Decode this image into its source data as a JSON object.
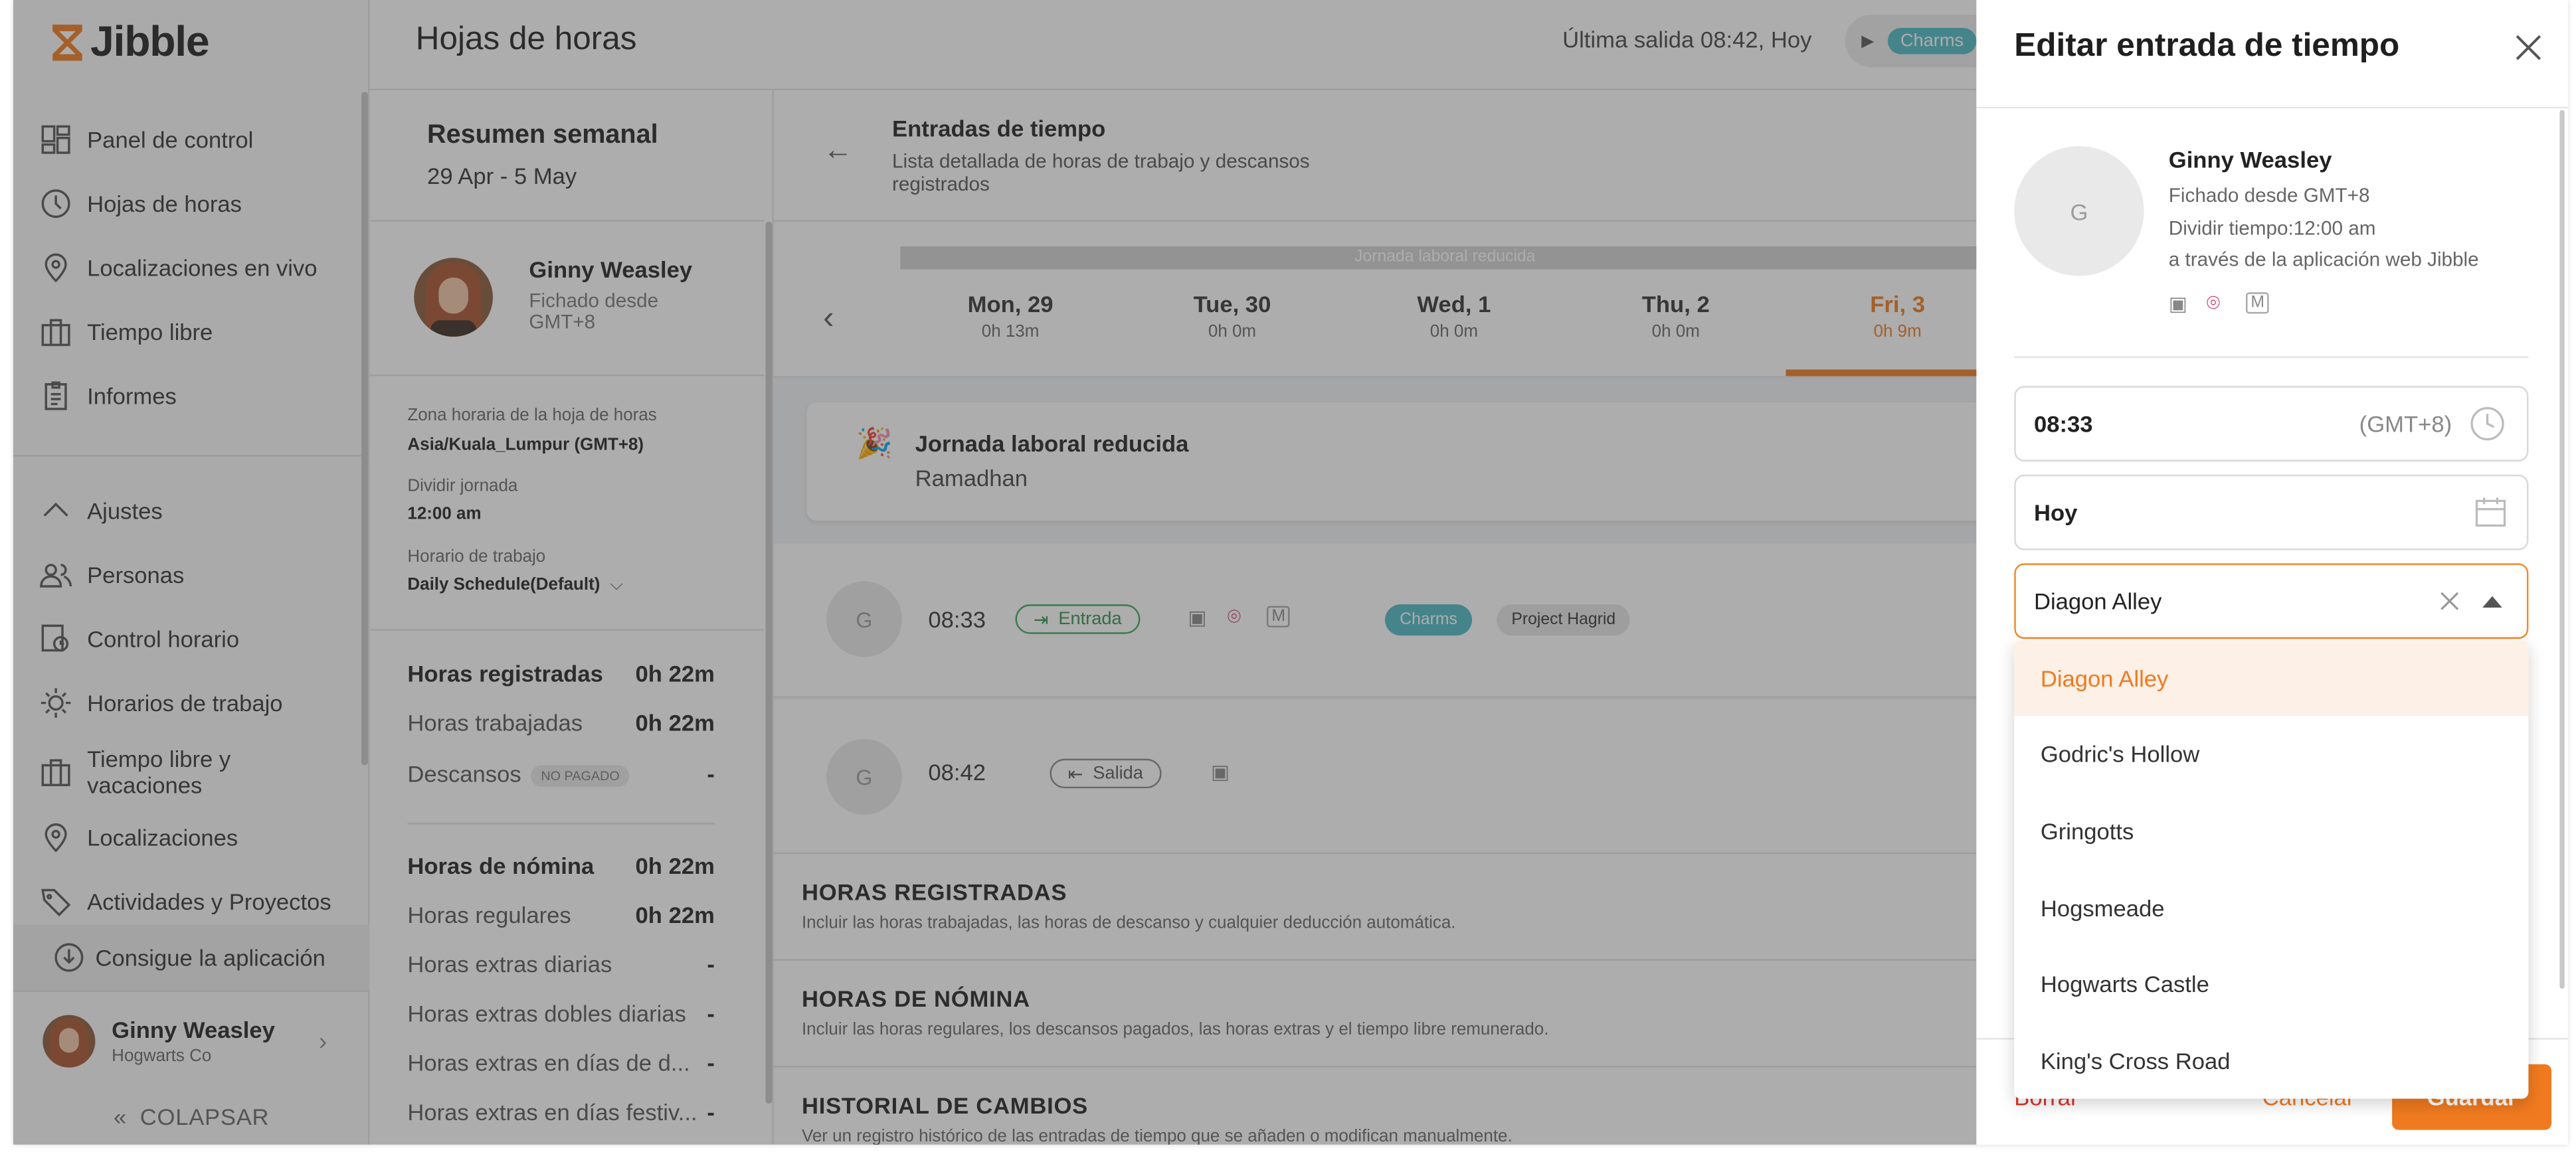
{
  "app": {
    "logo_text": "Jibble",
    "page_title": "Hojas de horas",
    "brand_color": "#f07a1f"
  },
  "sidebar": {
    "items": [
      {
        "label": "Panel de control",
        "icon": "dashboard-icon"
      },
      {
        "label": "Hojas de horas",
        "icon": "clock-icon"
      },
      {
        "label": "Localizaciones en vivo",
        "icon": "location-pin-icon"
      },
      {
        "label": "Tiempo libre",
        "icon": "briefcase-icon"
      },
      {
        "label": "Informes",
        "icon": "clipboard-icon"
      }
    ],
    "settings_label": "Ajustes",
    "settings_items": [
      {
        "label": "Personas",
        "icon": "people-icon"
      },
      {
        "label": "Control horario",
        "icon": "time-tracking-icon"
      },
      {
        "label": "Horarios de trabajo",
        "icon": "sun-schedule-icon"
      },
      {
        "label": "Tiempo libre y vacaciones",
        "icon": "briefcase-icon"
      },
      {
        "label": "Localizaciones",
        "icon": "location-pin-icon"
      },
      {
        "label": "Actividades y Proyectos",
        "icon": "tag-icon"
      }
    ],
    "get_app": "Consigue la aplicación",
    "user": {
      "name": "Ginny Weasley",
      "org": "Hogwarts Co"
    },
    "collapse": "COLAPSAR"
  },
  "header": {
    "last_out": "Última salida 08:42, Hoy",
    "clock_chip": "Charms"
  },
  "weekly": {
    "title": "Resumen semanal",
    "range": "29 Apr - 5 May",
    "person": {
      "name": "Ginny Weasley",
      "clocked": "Fichado desde GMT+8"
    },
    "tz_label": "Zona horaria de la hoja de horas",
    "tz_value": "Asia/Kuala_Lumpur (GMT+8)",
    "split_label": "Dividir jornada",
    "split_value": "12:00 am",
    "schedule_label": "Horario de trabajo",
    "schedule_value": "Daily Schedule(Default)",
    "tracked": [
      {
        "label": "Horas registradas",
        "value": "0h 22m",
        "bold": true
      },
      {
        "label": "Horas trabajadas",
        "value": "0h 22m"
      },
      {
        "label": "Descansos",
        "value": "-",
        "badge": "NO PAGADO"
      }
    ],
    "payroll": [
      {
        "label": "Horas de nómina",
        "value": "0h 22m",
        "bold": true
      },
      {
        "label": "Horas regulares",
        "value": "0h 22m"
      },
      {
        "label": "Horas extras diarias",
        "value": "-"
      },
      {
        "label": "Horas extras dobles diarias",
        "value": "-"
      },
      {
        "label": "Horas extras en días de d...",
        "value": "-"
      },
      {
        "label": "Horas extras en días festiv...",
        "value": "-"
      }
    ]
  },
  "entries": {
    "title": "Entradas de tiempo",
    "subtitle": "Lista detallada de horas de trabajo y descansos registrados",
    "reduced_bar": "Jornada laboral reducida",
    "days": [
      {
        "name": "Mon, 29",
        "hours": "0h 13m"
      },
      {
        "name": "Tue, 30",
        "hours": "0h 0m"
      },
      {
        "name": "Wed, 1",
        "hours": "0h 0m"
      },
      {
        "name": "Thu, 2",
        "hours": "0h 0m"
      },
      {
        "name": "Fri, 3",
        "hours": "0h 9m",
        "active": true
      }
    ],
    "holiday": {
      "title": "Jornada laboral reducida",
      "name": "Ramadhan"
    },
    "rows": [
      {
        "avatar": "G",
        "time": "08:33",
        "type": "Entrada",
        "activity": "Charms",
        "project": "Project Hagrid"
      },
      {
        "avatar": "G",
        "time": "08:42",
        "type": "Salida"
      }
    ],
    "sections": [
      {
        "title": "HORAS REGISTRADAS",
        "desc": "Incluir las horas trabajadas, las horas de descanso y cualquier deducción automática."
      },
      {
        "title": "HORAS DE NÓMINA",
        "desc": "Incluir las horas regulares, los descansos pagados, las horas extras y el tiempo libre remunerado."
      },
      {
        "title": "HISTORIAL DE CAMBIOS",
        "desc": "Ver un registro histórico de las entradas de tiempo que se añaden o modifican manualmente."
      }
    ]
  },
  "panel": {
    "title": "Editar entrada de tiempo",
    "person": {
      "avatar": "G",
      "name": "Ginny Weasley",
      "clocked": "Fichado desde GMT+8",
      "split": "Dividir tiempo:12:00 am",
      "via": "a través de la aplicación web Jibble"
    },
    "time": {
      "value": "08:33",
      "tz": "(GMT+8)"
    },
    "date": {
      "value": "Hoy"
    },
    "location": {
      "value": "Diagon Alley"
    },
    "options": [
      "Diagon Alley",
      "Godric's Hollow",
      "Gringotts",
      "Hogsmeade",
      "Hogwarts Castle",
      "King's Cross Road"
    ],
    "footer": {
      "delete": "Borrar",
      "cancel": "Cancelar",
      "save": "Guardar"
    }
  }
}
